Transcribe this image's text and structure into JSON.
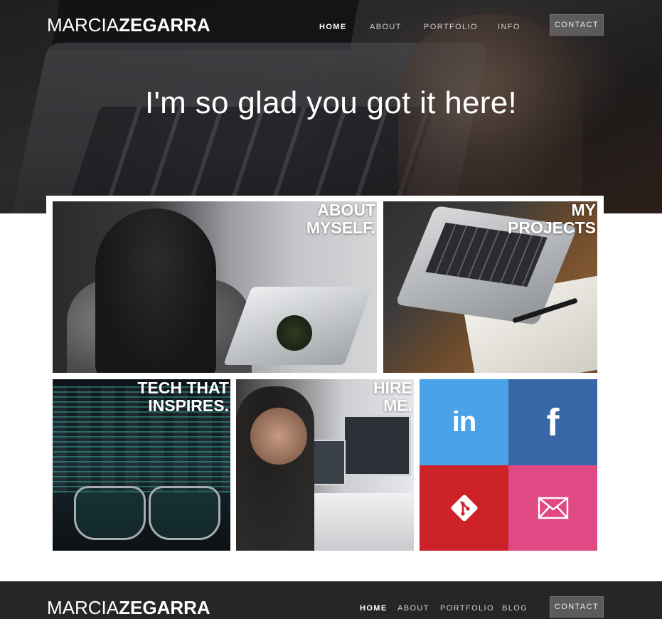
{
  "brand": {
    "logo_light": "MARCIA",
    "logo_bold": "ZEGARRA"
  },
  "header": {
    "nav": [
      {
        "label": "HOME",
        "active": true
      },
      {
        "label": "ABOUT"
      },
      {
        "label": "PORTFOLIO"
      },
      {
        "label": "INFO"
      }
    ],
    "contact_label": "CONTACT"
  },
  "hero": {
    "heading": "I'm so glad you got it here!"
  },
  "tiles": {
    "about": "ABOUT\nMYSELF.",
    "projects": "MY\nPROJECTS",
    "tech": "TECH THAT\nINSPIRES.",
    "hire": "HIRE\nME."
  },
  "social": {
    "linkedin": {
      "glyph": "in",
      "icon": "linkedin-icon",
      "color": "#4aa3e8"
    },
    "facebook": {
      "glyph": "f",
      "icon": "facebook-icon",
      "color": "#3866a7"
    },
    "git": {
      "icon": "git-icon",
      "color": "#cc2228"
    },
    "email": {
      "icon": "mail-icon",
      "color": "#df4a85"
    }
  },
  "footer": {
    "nav": [
      {
        "label": "HOME",
        "active": true
      },
      {
        "label": "ABOUT"
      },
      {
        "label": "PORTFOLIO"
      },
      {
        "label": "BLOG"
      }
    ],
    "contact_label": "CONTACT"
  }
}
